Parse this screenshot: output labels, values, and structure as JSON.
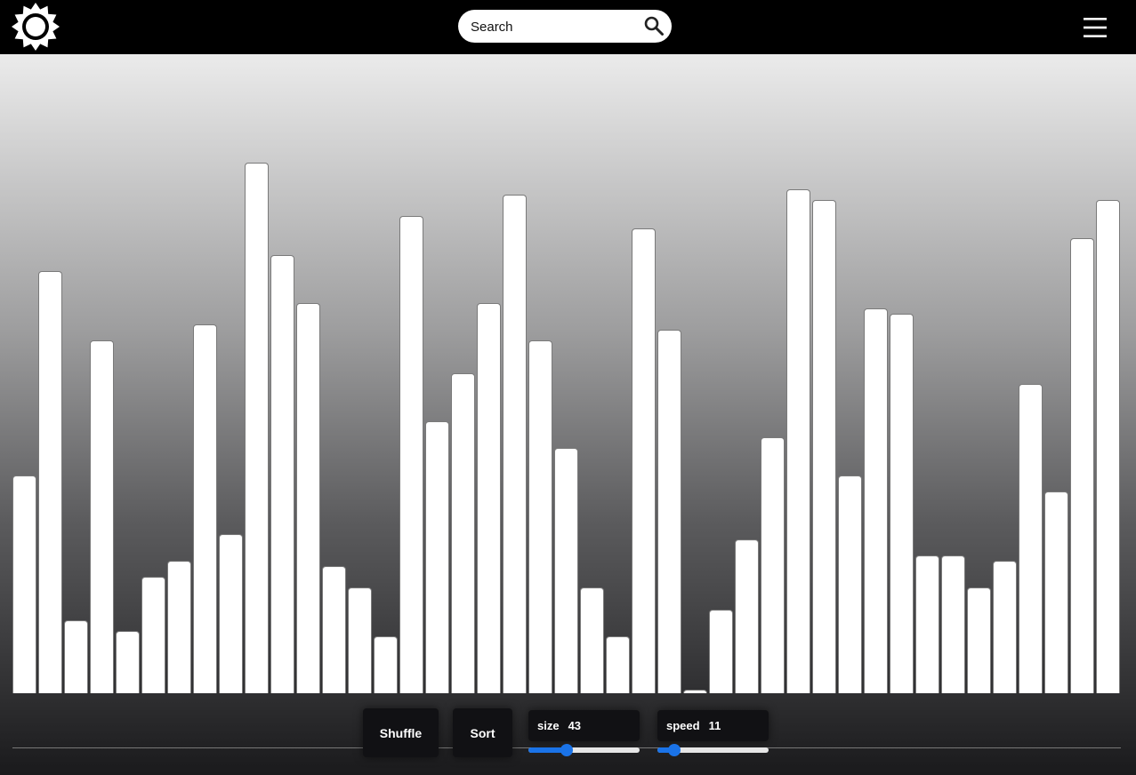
{
  "header": {
    "search_placeholder": "Search"
  },
  "icons": {
    "logo": "sun-icon",
    "search": "search-icon",
    "menu": "hamburger-menu-icon"
  },
  "colors": {
    "accent": "#1a73e8",
    "bar": "#ffffff",
    "topbar": "#000000",
    "control_bg": "#111114"
  },
  "chart_data": {
    "type": "bar",
    "values": [
      245,
      475,
      82,
      397,
      70,
      131,
      149,
      415,
      179,
      597,
      493,
      439,
      143,
      119,
      64,
      537,
      306,
      360,
      439,
      561,
      397,
      276,
      119,
      64,
      523,
      409,
      4,
      94,
      173,
      288,
      567,
      555,
      245,
      433,
      427,
      155,
      155,
      119,
      149,
      348,
      227,
      512,
      555
    ],
    "ylim": [
      0,
      719
    ],
    "grid": false
  },
  "controls": {
    "shuffle_label": "Shuffle",
    "sort_label": "Sort",
    "size_label": "size",
    "size_value": "43",
    "size_fraction": 0.34,
    "speed_label": "speed",
    "speed_value": "11",
    "speed_fraction": 0.15
  }
}
